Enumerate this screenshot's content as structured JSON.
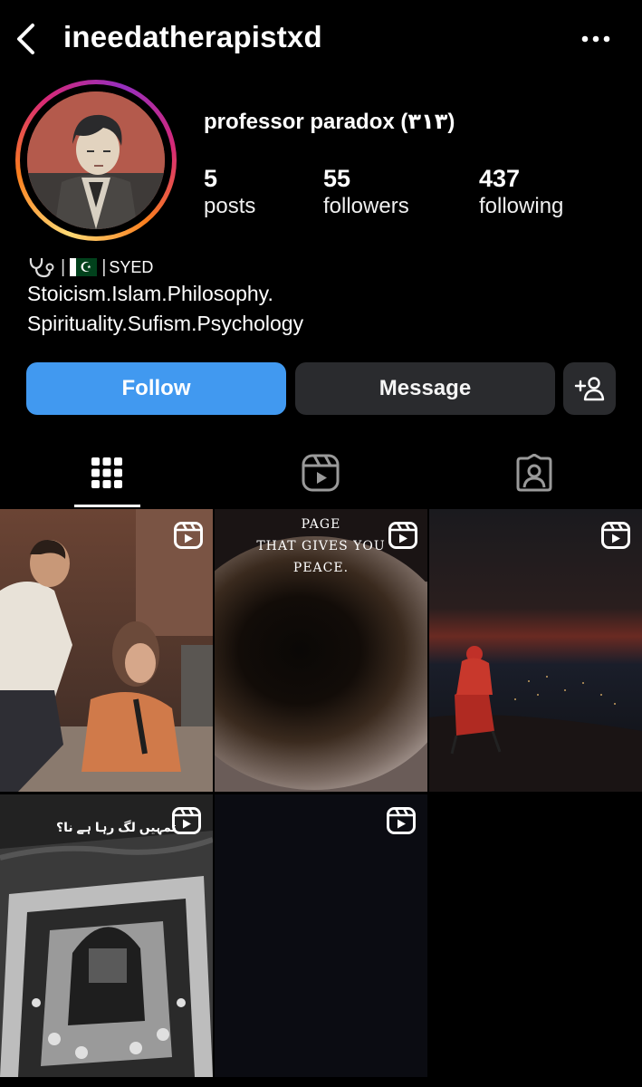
{
  "header": {
    "username": "ineedatherapistxd",
    "back_icon": "chevron-left-icon",
    "more_icon": "more-horizontal-icon"
  },
  "profile": {
    "display_name": "professor paradox (٣١٣)",
    "avatar_icon": "avatar-illustration",
    "stats": {
      "posts_count": "5",
      "posts_label": "posts",
      "followers_count": "55",
      "followers_label": "followers",
      "following_count": "437",
      "following_label": "following"
    },
    "bio": {
      "line1_text": "SYED",
      "line1_icons": [
        "stethoscope-icon",
        "pakistan-flag-icon"
      ],
      "line2": "Stoicism.Islam.Philosophy.",
      "line3": "Spirituality.Sufism.Psychology"
    }
  },
  "actions": {
    "follow_label": "Follow",
    "message_label": "Message",
    "add_user_icon": "add-user-icon"
  },
  "tabs": [
    {
      "name": "grid",
      "icon": "grid-icon",
      "active": true
    },
    {
      "name": "reels",
      "icon": "reels-icon",
      "active": false
    },
    {
      "name": "tagged",
      "icon": "tagged-person-icon",
      "active": false
    }
  ],
  "posts": [
    {
      "type": "reel",
      "overlay_text": ""
    },
    {
      "type": "reel",
      "overlay_text": "PAGE\nTHAT GIVES YOU\nPEACE."
    },
    {
      "type": "reel",
      "overlay_text": ""
    },
    {
      "type": "reel",
      "overlay_text": "تمہیں لگ رہا ہے نا؟"
    },
    {
      "type": "reel",
      "overlay_text": ""
    }
  ],
  "colors": {
    "background": "#000000",
    "follow_button": "#4199f0",
    "secondary_button": "#2a2b2e",
    "text": "#ffffff"
  }
}
